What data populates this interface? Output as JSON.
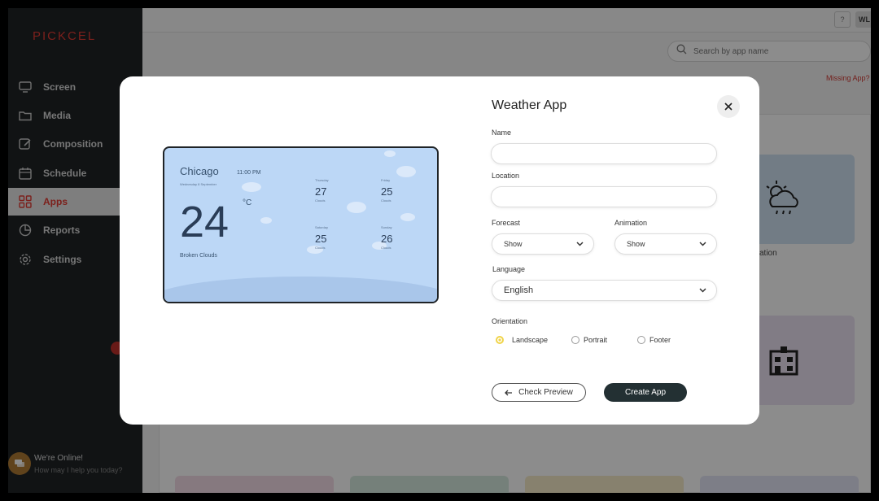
{
  "brand": {
    "logo": "PICKCEL",
    "accent": "#e23b33"
  },
  "sidebar": {
    "items": [
      {
        "label": "Screen",
        "icon": "monitor-icon"
      },
      {
        "label": "Media",
        "icon": "folder-icon"
      },
      {
        "label": "Composition",
        "icon": "pencil-icon"
      },
      {
        "label": "Schedule",
        "icon": "calendar-icon"
      },
      {
        "label": "Apps",
        "icon": "grid-icon",
        "active": true
      },
      {
        "label": "Reports",
        "icon": "pie-chart-icon"
      },
      {
        "label": "Settings",
        "icon": "gear-icon"
      }
    ],
    "chat": {
      "title": "We're Online!",
      "subtitle": "How may I help you today?"
    }
  },
  "topbar": {
    "help": "?",
    "user": "WL"
  },
  "search": {
    "placeholder": "Search by app name"
  },
  "missing_app": "Missing App?",
  "tiles": {
    "weather_label": "ation"
  },
  "modal": {
    "title": "Weather App",
    "fields": {
      "name_label": "Name",
      "name_value": "",
      "location_label": "Location",
      "location_value": "",
      "forecast_label": "Forecast",
      "forecast_value": "Show",
      "animation_label": "Animation",
      "animation_value": "Show",
      "language_label": "Language",
      "language_value": "English",
      "orientation_label": "Orientation",
      "orientations": [
        {
          "label": "Landscape",
          "checked": true
        },
        {
          "label": "Portrait",
          "checked": false
        },
        {
          "label": "Footer",
          "checked": false
        }
      ]
    },
    "buttons": {
      "preview": "Check Preview",
      "create": "Create App"
    },
    "preview": {
      "city": "Chicago",
      "date": "Wednesday 8 September",
      "time": "11:00 PM",
      "temp": "24",
      "unit": "°C",
      "condition": "Broken Clouds",
      "forecast": [
        {
          "day": "Thursday",
          "temp": "27",
          "low": "Clouds"
        },
        {
          "day": "Friday",
          "temp": "25",
          "low": "Clouds"
        },
        {
          "day": "Saturday",
          "temp": "25",
          "low": "Clouds"
        },
        {
          "day": "Sunday",
          "temp": "26",
          "low": "Clouds"
        }
      ]
    }
  }
}
